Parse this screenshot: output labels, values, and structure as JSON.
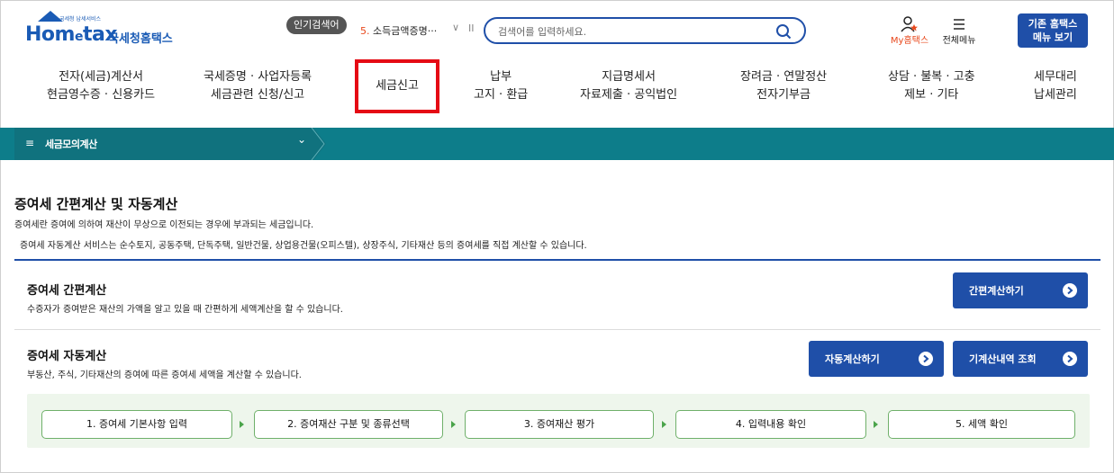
{
  "header": {
    "logo_tiny": "국세청 납세서비스",
    "logo_main": "Hom",
    "logo_e": "e",
    "logo_tax": "tax",
    "logo_sub": "국세청홈택스",
    "popular_badge": "인기검색어",
    "popular_rank": "5.",
    "popular_term": "소득금액증명···",
    "popular_chevron": "∨",
    "popular_pause": "II",
    "search_placeholder": "검색어를 입력하세요.",
    "myhome_label": "My홈택스",
    "allmenu_label": "전체메뉴",
    "legacy_line1": "기존 홈택스",
    "legacy_line2": "메뉴 보기"
  },
  "nav": {
    "items": [
      {
        "line1": "전자(세금)계산서",
        "line2": "현금영수증 · 신용카드"
      },
      {
        "line1": "국세증명 · 사업자등록",
        "line2": "세금관련 신청/신고"
      },
      {
        "line1": "세금신고",
        "line2": ""
      },
      {
        "line1": "납부",
        "line2": "고지 · 환급"
      },
      {
        "line1": "지급명세서",
        "line2": "자료제출 · 공익법인"
      },
      {
        "line1": "장려금 · 연말정산",
        "line2": "전자기부금"
      },
      {
        "line1": "상담 · 불복 · 고충",
        "line2": "제보 · 기타"
      },
      {
        "line1": "세무대리",
        "line2": "납세관리"
      }
    ],
    "selected_color": "#e50a14"
  },
  "breadcrumb": {
    "hamburger": "≡",
    "label": "세금모의계산",
    "chevron": "⌄",
    "bar_color": "#0d7d8a"
  },
  "content": {
    "title": "증여세 간편계산 및 자동계산",
    "desc1": "증여세란 증여에 의하여 재산이 무상으로 이전되는 경우에 부과되는 세금입니다.",
    "desc2": "증여세 자동계산 서비스는 순수토지, 공동주택, 단독주택, 일반건물, 상업용건물(오피스텔), 상장주식, 기타재산 등의 증여세를 직접 계산할 수 있습니다.",
    "simple": {
      "title": "증여세 간편계산",
      "desc": "수증자가 증여받은 재산의 가액을 알고 있을 때 간편하게 세액계산을 할 수 있습니다.",
      "button": "간편계산하기"
    },
    "auto": {
      "title": "증여세 자동계산",
      "desc": "부동산, 주식, 기타재산의 증여에 따른 증여세 세액을 계산할 수 있습니다.",
      "button_auto": "자동계산하기",
      "button_history": "기계산내역 조회"
    },
    "steps": [
      "1. 증여세 기본사항 입력",
      "2. 증여재산 구분 및 종류선택",
      "3. 증여재산 평가",
      "4. 입력내용 확인",
      "5. 세액 확인"
    ],
    "accent_color": "#1f4fa8"
  }
}
